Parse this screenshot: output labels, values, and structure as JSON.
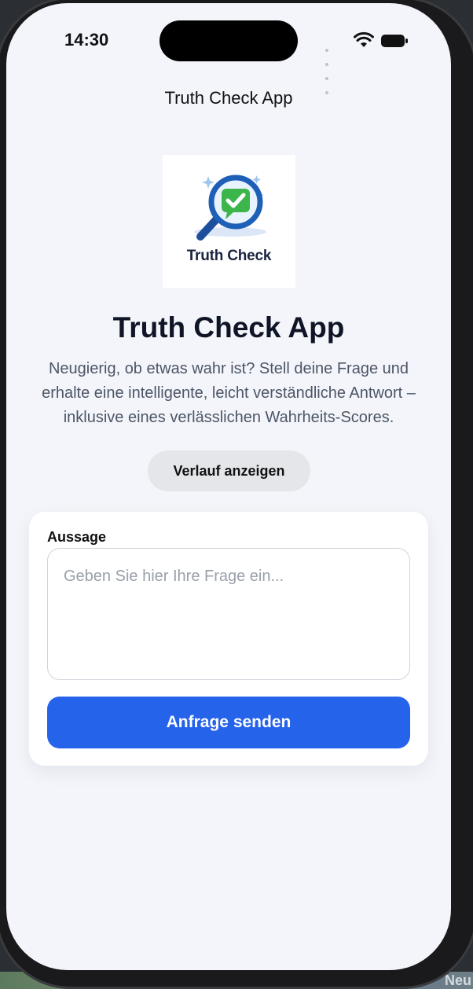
{
  "status_bar": {
    "time": "14:30"
  },
  "nav": {
    "title": "Truth Check App"
  },
  "logo": {
    "caption": "Truth Check"
  },
  "hero": {
    "title": "Truth Check App",
    "description": "Neugierig, ob etwas wahr ist? Stell deine Frage und erhalte eine intelligente, leicht verständliche Antwort – inklusive eines verlässlichen Wahrheits-Scores."
  },
  "history_button": {
    "label": "Verlauf anzeigen"
  },
  "form": {
    "label": "Aussage",
    "placeholder": "Geben Sie hier Ihre Frage ein...",
    "submit_label": "Anfrage senden"
  },
  "background_peek": {
    "text": "Neu"
  },
  "colors": {
    "accent": "#2563eb",
    "screen_bg": "#f3f5fa",
    "secondary_button": "#e4e6ea",
    "logo_green": "#3cb54a",
    "logo_blue": "#1e5fb8"
  }
}
